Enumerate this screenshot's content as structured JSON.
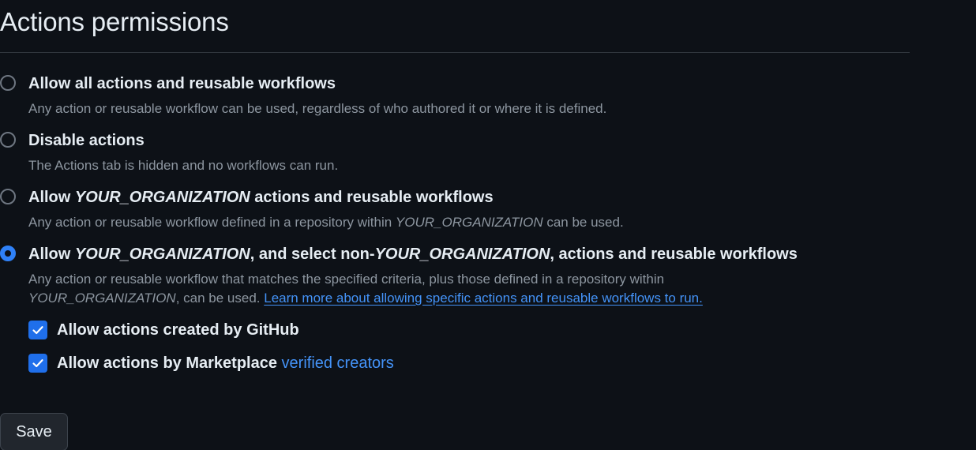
{
  "page": {
    "title": "Actions permissions"
  },
  "org": "YOUR_ORGANIZATION",
  "options": [
    {
      "label": "Allow all actions and reusable workflows",
      "description": "Any action or reusable workflow can be used, regardless of who authored it or where it is defined.",
      "selected": false
    },
    {
      "label": "Disable actions",
      "description": "The Actions tab is hidden and no workflows can run.",
      "selected": false
    },
    {
      "label_prefix": "Allow ",
      "label_suffix": " actions and reusable workflows",
      "description_prefix": "Any action or reusable workflow defined in a repository within ",
      "description_suffix": " can be used.",
      "selected": false
    },
    {
      "label_prefix": "Allow ",
      "label_middle": ", and select non-",
      "label_suffix": ", actions and reusable workflows",
      "description_line1": "Any action or reusable workflow that matches the specified criteria, plus those defined in a repository within",
      "description_line2_suffix": ", can be used. ",
      "learn_more_link": "Learn more about allowing specific actions and reusable workflows to run.",
      "selected": true
    }
  ],
  "checkboxes": [
    {
      "label": "Allow actions created by GitHub",
      "checked": true
    },
    {
      "label_prefix": "Allow actions by Marketplace ",
      "link": "verified creators",
      "checked": true
    }
  ],
  "save_button": {
    "label": "Save"
  },
  "colors": {
    "background": "#0d1117",
    "accent": "#2f81f7",
    "link": "#4493f8",
    "muted_text": "#8d96a0"
  }
}
